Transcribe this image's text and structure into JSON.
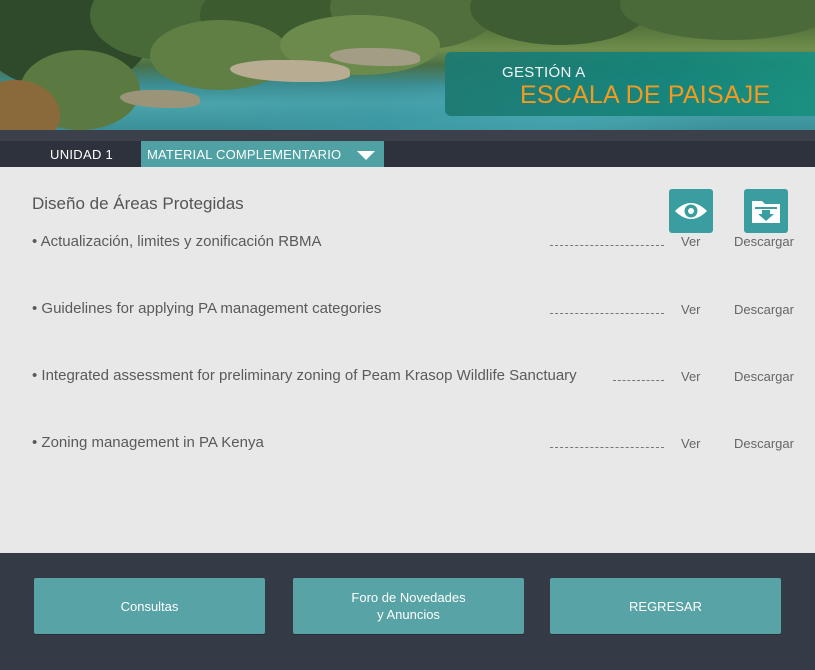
{
  "header": {
    "title_line1": "GESTIÓN A",
    "title_line2": "ESCALA DE PAISAJE",
    "title_accent_color": "#f39a1f"
  },
  "tabs": {
    "unit_label": "UNIDAD 1",
    "material_label": "MATERIAL COMPLEMENTARIO",
    "material_icon": "chevron-down-icon"
  },
  "content": {
    "section_title": "Diseño de Áreas Protegidas",
    "view_icon": "eye-icon",
    "download_icon": "folder-download-icon",
    "items": [
      {
        "text": "• Actualización, limites y zonificación RBMA",
        "view": "Ver",
        "download": "Descargar"
      },
      {
        "text": "• Guidelines for applying PA management categories",
        "view": "Ver",
        "download": "Descargar"
      },
      {
        "text": "• Integrated assessment for preliminary zoning of Peam Krasop Wildlife Sanctuary",
        "view": "Ver",
        "download": "Descargar"
      },
      {
        "text": "• Zoning management in PA Kenya",
        "view": "Ver",
        "download": "Descargar"
      }
    ]
  },
  "footer": {
    "consultas_label": "Consultas",
    "foro_label_line1": "Foro de Novedades",
    "foro_label_line2": "y Anuncios",
    "regresar_label": "REGRESAR"
  },
  "colors": {
    "accent_teal": "#4fa1a3",
    "footer_bg": "#343b47",
    "content_bg": "#e8e8e8"
  }
}
